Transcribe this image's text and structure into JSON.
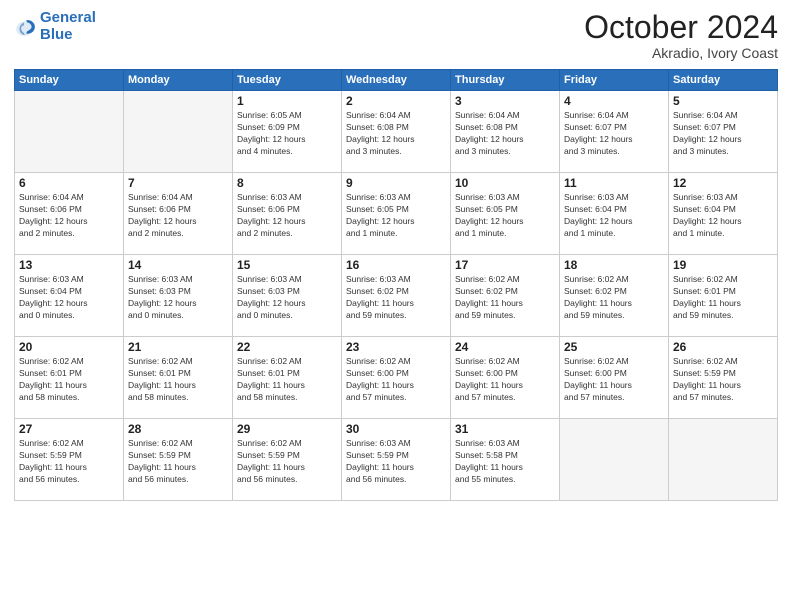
{
  "header": {
    "logo_line1": "General",
    "logo_line2": "Blue",
    "month": "October 2024",
    "location": "Akradio, Ivory Coast"
  },
  "weekdays": [
    "Sunday",
    "Monday",
    "Tuesday",
    "Wednesday",
    "Thursday",
    "Friday",
    "Saturday"
  ],
  "weeks": [
    [
      {
        "day": "",
        "info": ""
      },
      {
        "day": "",
        "info": ""
      },
      {
        "day": "1",
        "info": "Sunrise: 6:05 AM\nSunset: 6:09 PM\nDaylight: 12 hours\nand 4 minutes."
      },
      {
        "day": "2",
        "info": "Sunrise: 6:04 AM\nSunset: 6:08 PM\nDaylight: 12 hours\nand 3 minutes."
      },
      {
        "day": "3",
        "info": "Sunrise: 6:04 AM\nSunset: 6:08 PM\nDaylight: 12 hours\nand 3 minutes."
      },
      {
        "day": "4",
        "info": "Sunrise: 6:04 AM\nSunset: 6:07 PM\nDaylight: 12 hours\nand 3 minutes."
      },
      {
        "day": "5",
        "info": "Sunrise: 6:04 AM\nSunset: 6:07 PM\nDaylight: 12 hours\nand 3 minutes."
      }
    ],
    [
      {
        "day": "6",
        "info": "Sunrise: 6:04 AM\nSunset: 6:06 PM\nDaylight: 12 hours\nand 2 minutes."
      },
      {
        "day": "7",
        "info": "Sunrise: 6:04 AM\nSunset: 6:06 PM\nDaylight: 12 hours\nand 2 minutes."
      },
      {
        "day": "8",
        "info": "Sunrise: 6:03 AM\nSunset: 6:06 PM\nDaylight: 12 hours\nand 2 minutes."
      },
      {
        "day": "9",
        "info": "Sunrise: 6:03 AM\nSunset: 6:05 PM\nDaylight: 12 hours\nand 1 minute."
      },
      {
        "day": "10",
        "info": "Sunrise: 6:03 AM\nSunset: 6:05 PM\nDaylight: 12 hours\nand 1 minute."
      },
      {
        "day": "11",
        "info": "Sunrise: 6:03 AM\nSunset: 6:04 PM\nDaylight: 12 hours\nand 1 minute."
      },
      {
        "day": "12",
        "info": "Sunrise: 6:03 AM\nSunset: 6:04 PM\nDaylight: 12 hours\nand 1 minute."
      }
    ],
    [
      {
        "day": "13",
        "info": "Sunrise: 6:03 AM\nSunset: 6:04 PM\nDaylight: 12 hours\nand 0 minutes."
      },
      {
        "day": "14",
        "info": "Sunrise: 6:03 AM\nSunset: 6:03 PM\nDaylight: 12 hours\nand 0 minutes."
      },
      {
        "day": "15",
        "info": "Sunrise: 6:03 AM\nSunset: 6:03 PM\nDaylight: 12 hours\nand 0 minutes."
      },
      {
        "day": "16",
        "info": "Sunrise: 6:03 AM\nSunset: 6:02 PM\nDaylight: 11 hours\nand 59 minutes."
      },
      {
        "day": "17",
        "info": "Sunrise: 6:02 AM\nSunset: 6:02 PM\nDaylight: 11 hours\nand 59 minutes."
      },
      {
        "day": "18",
        "info": "Sunrise: 6:02 AM\nSunset: 6:02 PM\nDaylight: 11 hours\nand 59 minutes."
      },
      {
        "day": "19",
        "info": "Sunrise: 6:02 AM\nSunset: 6:01 PM\nDaylight: 11 hours\nand 59 minutes."
      }
    ],
    [
      {
        "day": "20",
        "info": "Sunrise: 6:02 AM\nSunset: 6:01 PM\nDaylight: 11 hours\nand 58 minutes."
      },
      {
        "day": "21",
        "info": "Sunrise: 6:02 AM\nSunset: 6:01 PM\nDaylight: 11 hours\nand 58 minutes."
      },
      {
        "day": "22",
        "info": "Sunrise: 6:02 AM\nSunset: 6:01 PM\nDaylight: 11 hours\nand 58 minutes."
      },
      {
        "day": "23",
        "info": "Sunrise: 6:02 AM\nSunset: 6:00 PM\nDaylight: 11 hours\nand 57 minutes."
      },
      {
        "day": "24",
        "info": "Sunrise: 6:02 AM\nSunset: 6:00 PM\nDaylight: 11 hours\nand 57 minutes."
      },
      {
        "day": "25",
        "info": "Sunrise: 6:02 AM\nSunset: 6:00 PM\nDaylight: 11 hours\nand 57 minutes."
      },
      {
        "day": "26",
        "info": "Sunrise: 6:02 AM\nSunset: 5:59 PM\nDaylight: 11 hours\nand 57 minutes."
      }
    ],
    [
      {
        "day": "27",
        "info": "Sunrise: 6:02 AM\nSunset: 5:59 PM\nDaylight: 11 hours\nand 56 minutes."
      },
      {
        "day": "28",
        "info": "Sunrise: 6:02 AM\nSunset: 5:59 PM\nDaylight: 11 hours\nand 56 minutes."
      },
      {
        "day": "29",
        "info": "Sunrise: 6:02 AM\nSunset: 5:59 PM\nDaylight: 11 hours\nand 56 minutes."
      },
      {
        "day": "30",
        "info": "Sunrise: 6:03 AM\nSunset: 5:59 PM\nDaylight: 11 hours\nand 56 minutes."
      },
      {
        "day": "31",
        "info": "Sunrise: 6:03 AM\nSunset: 5:58 PM\nDaylight: 11 hours\nand 55 minutes."
      },
      {
        "day": "",
        "info": ""
      },
      {
        "day": "",
        "info": ""
      }
    ]
  ]
}
